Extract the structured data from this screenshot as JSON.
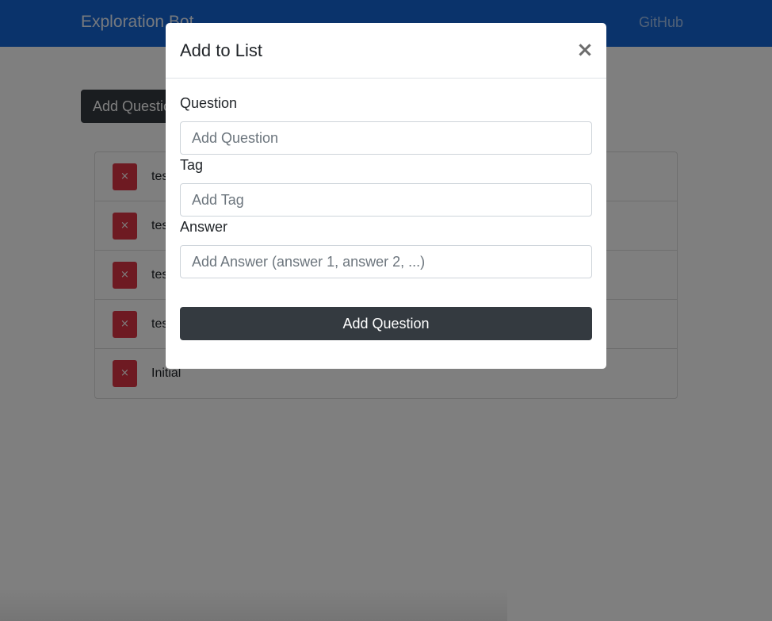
{
  "navbar": {
    "brand": "Exploration Bot",
    "github_link": "GitHub"
  },
  "main": {
    "add_button_label": "Add Question",
    "list_items": [
      {
        "delete_label": "×",
        "text": "tes"
      },
      {
        "delete_label": "×",
        "text": "tes"
      },
      {
        "delete_label": "×",
        "text": "tes"
      },
      {
        "delete_label": "×",
        "text": "tes"
      },
      {
        "delete_label": "×",
        "text": "Initial"
      }
    ]
  },
  "modal": {
    "title": "Add to List",
    "close_label": "×",
    "fields": {
      "question": {
        "label": "Question",
        "value": "",
        "placeholder": "Add Question"
      },
      "tag": {
        "label": "Tag",
        "value": "",
        "placeholder": "Add Tag"
      },
      "answer": {
        "label": "Answer",
        "value": "",
        "placeholder": "Add Answer (answer 1, answer 2, ...)"
      }
    },
    "submit_label": "Add Question"
  },
  "colors": {
    "navbar": "#1566d6",
    "primary_dark": "#343a40",
    "danger": "#dc3545"
  }
}
